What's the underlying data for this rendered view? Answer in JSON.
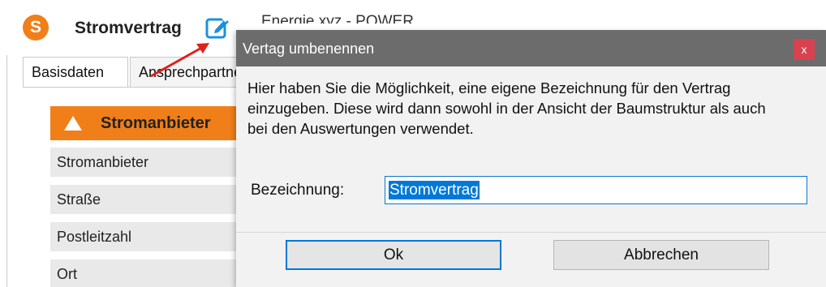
{
  "app": {
    "logo_letter": "S",
    "title": "Stromvertrag",
    "subtitle": "Energie xyz - POWER"
  },
  "tabs": [
    {
      "label": "Basisdaten",
      "active": true
    },
    {
      "label": "Ansprechpartner",
      "active": false
    }
  ],
  "section": {
    "title": "Stromanbieter",
    "fields": [
      "Stromanbieter",
      "Straße",
      "Postleitzahl",
      "Ort"
    ]
  },
  "dialog": {
    "title": "Vertag umbenennen",
    "close_label": "x",
    "description": "Hier haben Sie die Möglichkeit, eine eigene Bezeichnung für den Vertrag einzugeben. Diese wird dann sowohl in der Ansicht der Baumstruktur als auch bei den Auswertungen verwendet.",
    "field_label": "Bezeichnung:",
    "field_value": "Stromvertrag",
    "ok_label": "Ok",
    "cancel_label": "Abbrechen"
  },
  "colors": {
    "accent_orange": "#f07f19",
    "titlebar_gray": "#6c6c6c",
    "close_red": "#d9414f",
    "selection_blue": "#0078d7",
    "arrow_red": "#e0201c"
  },
  "icons": {
    "edit": "pencil-square-icon",
    "warning": "warning-triangle-icon",
    "close": "close-icon"
  }
}
